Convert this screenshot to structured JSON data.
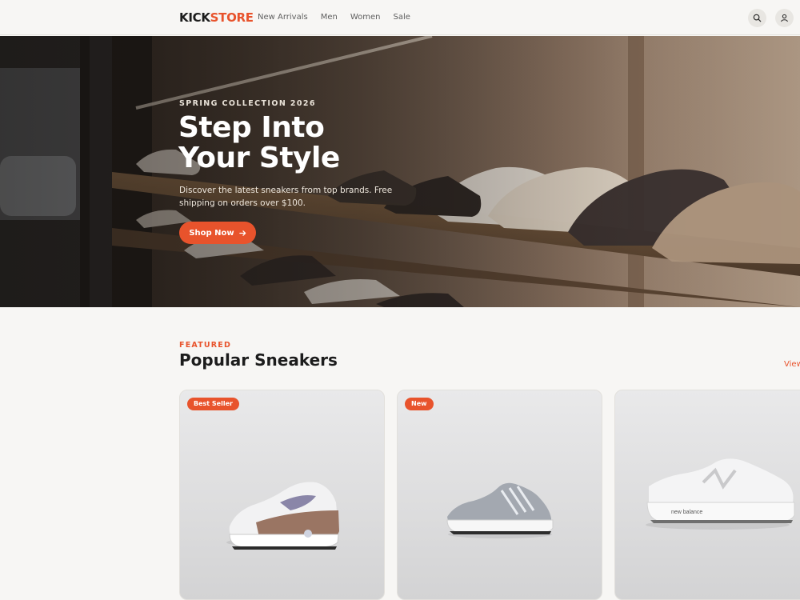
{
  "header": {
    "logo": {
      "part1": "KICK",
      "part2": "STORE"
    },
    "nav": [
      "New Arrivals",
      "Men",
      "Women",
      "Sale"
    ],
    "icons": [
      "search-icon",
      "user-icon"
    ]
  },
  "hero": {
    "eyebrow": "SPRING COLLECTION 2026",
    "title_line1": "Step Into",
    "title_line2": "Your Style",
    "subtitle": "Discover the latest sneakers from top brands. Free shipping on orders over $100.",
    "cta_label": "Shop Now",
    "cta_icon": "arrow-right-icon"
  },
  "featured": {
    "eyebrow": "FEATURED",
    "title": "Popular Sneakers",
    "view_all": "View"
  },
  "products": [
    {
      "badge": "Best Seller"
    },
    {
      "badge": "New"
    },
    {
      "badge": ""
    }
  ],
  "colors": {
    "accent": "#e8532c",
    "background": "#f7f6f4",
    "text": "#1c1c1c"
  }
}
